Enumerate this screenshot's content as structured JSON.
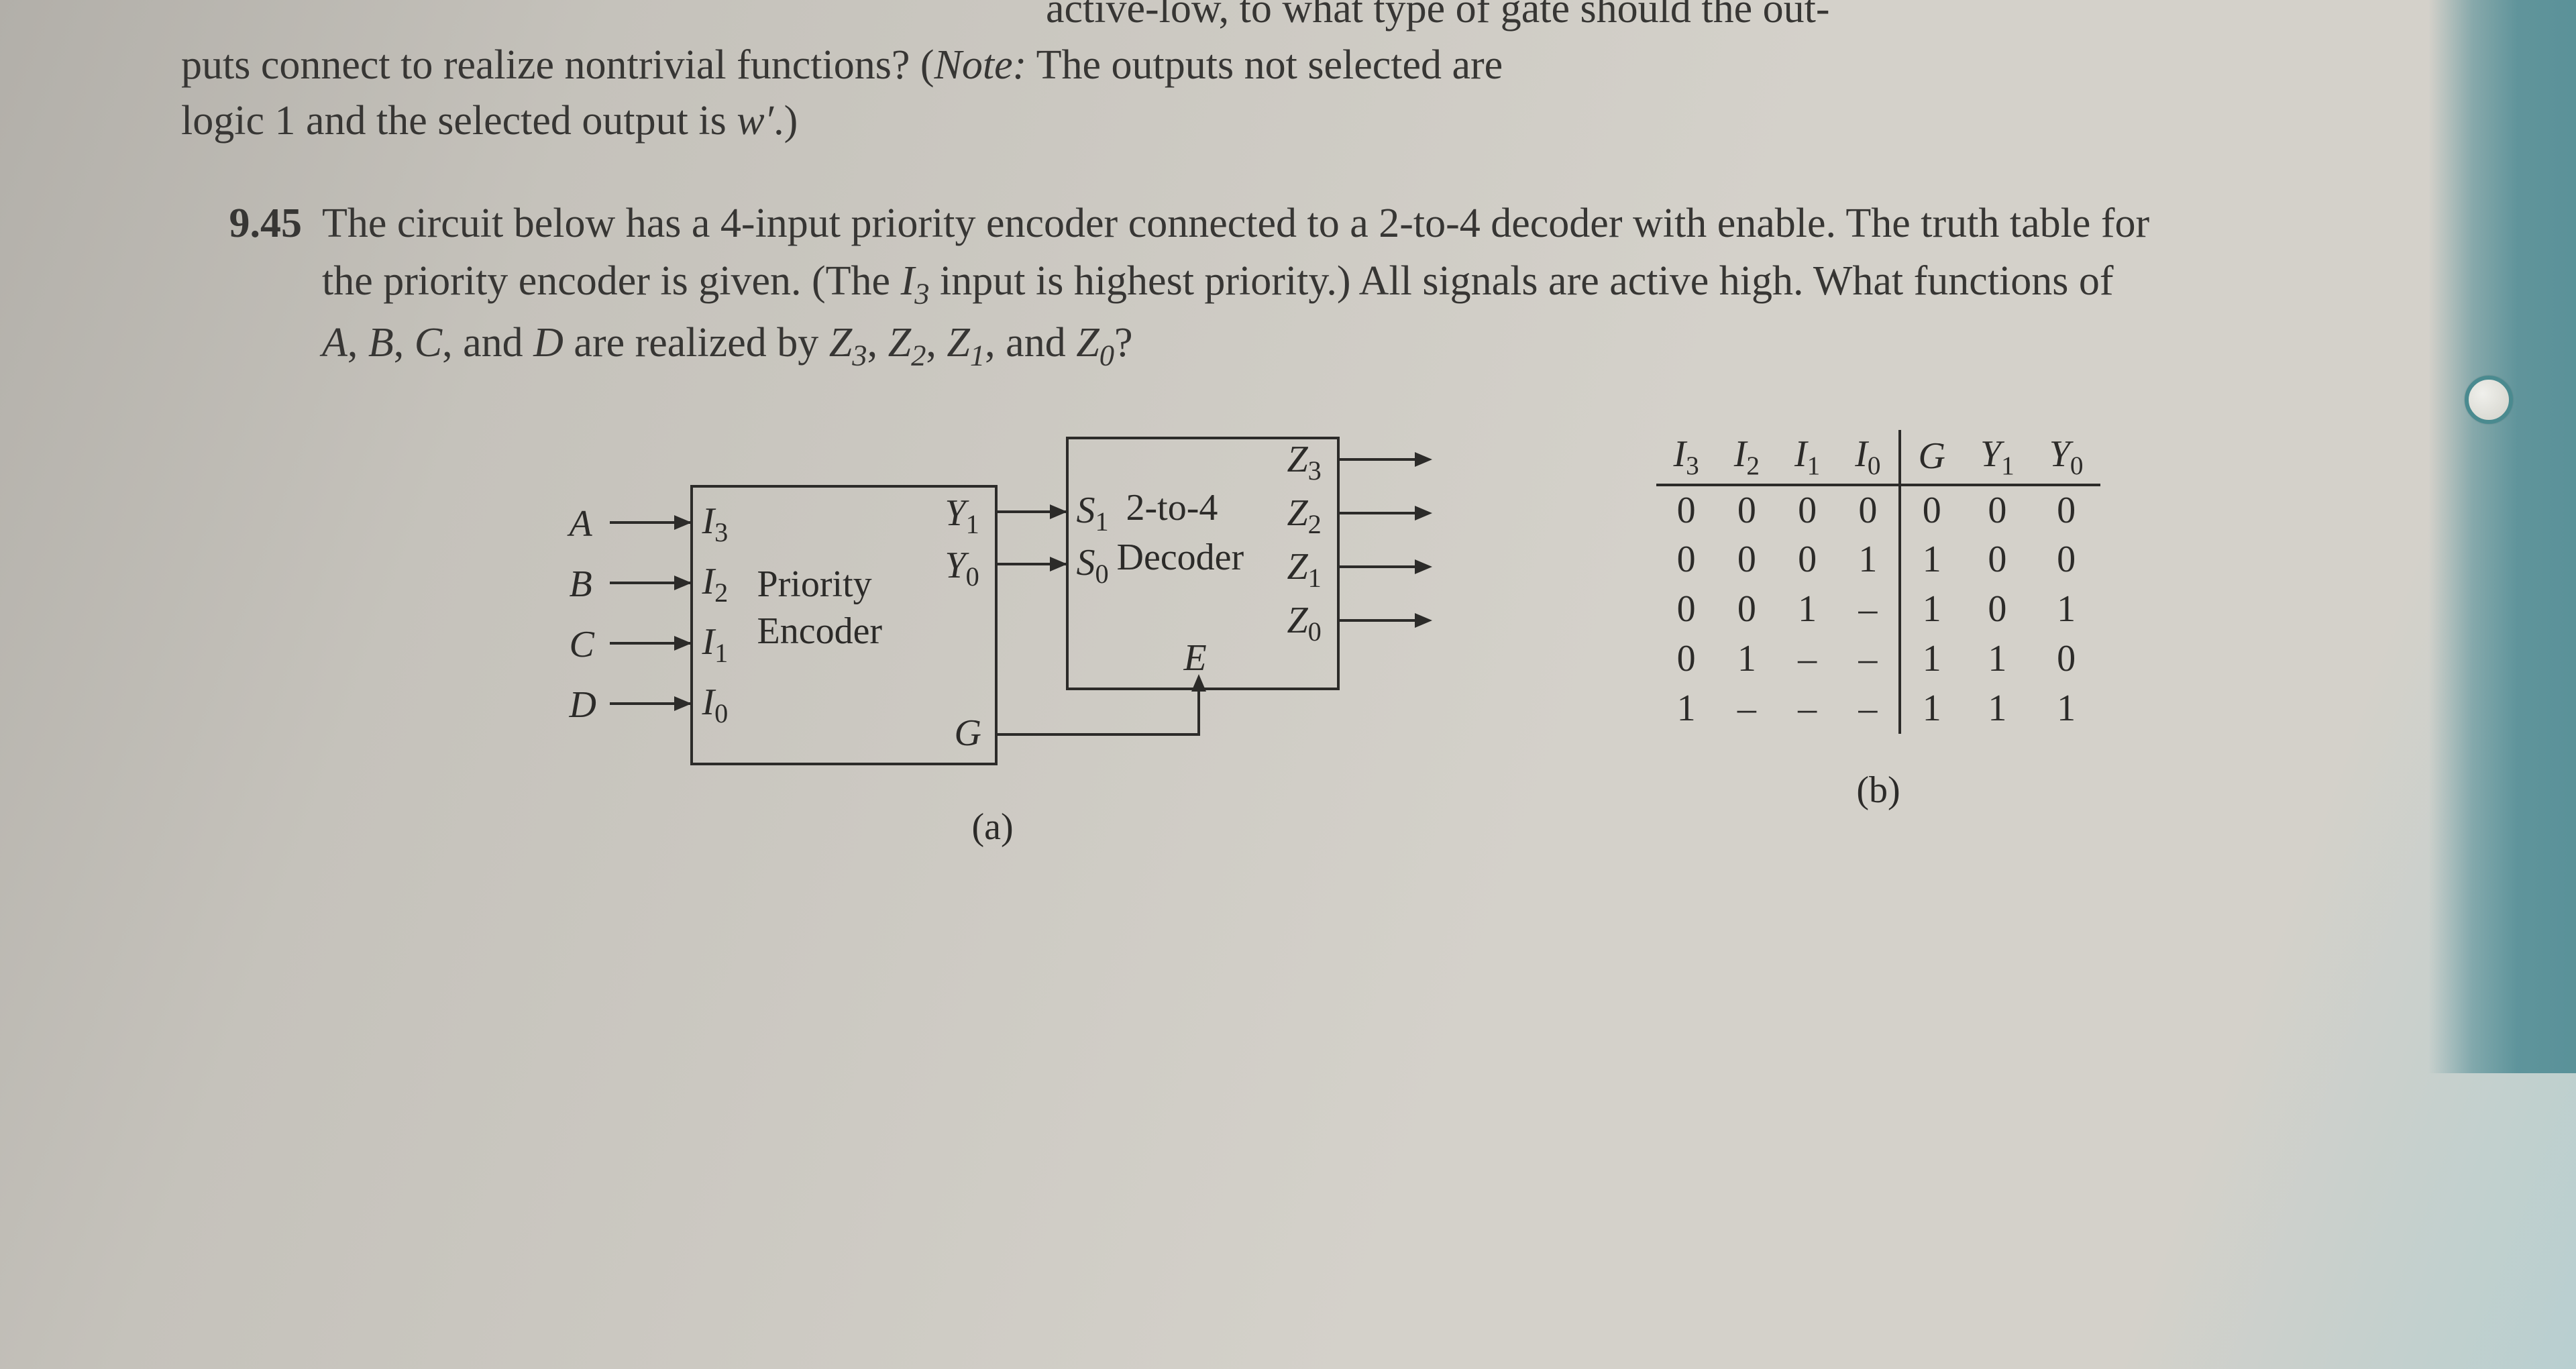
{
  "partialProblem": {
    "line1_fragment": "active-low, to what type of gate should the out-",
    "line2": "puts connect to realize nontrivial functions? (",
    "note_label": "Note:",
    "line2b": " The outputs not selected are",
    "line3a": "logic 1 and the selected output is ",
    "line3_var": "w′",
    "line3b": ".)"
  },
  "problem945": {
    "number": "9.45",
    "text_a": "The circuit below has a 4-input priority encoder connected to a 2-to-4 decoder with enable. The truth table for the priority encoder is given. (The ",
    "I3": "I",
    "I3_sub": "3",
    "text_b": " input is highest priority.) All signals are active high. What functions of ",
    "A": "A",
    "comma1": ", ",
    "B": "B",
    "comma2": ", ",
    "C": "C",
    "comma3": ", and ",
    "D": "D",
    "text_c": " are realized by ",
    "Z3": "Z",
    "Z3s": "3",
    "Z2": "Z",
    "Z2s": "2",
    "Z1": "Z",
    "Z1s": "1",
    "and": ", and ",
    "Z0": "Z",
    "Z0s": "0",
    "q": "?"
  },
  "diagram": {
    "inputs": {
      "A": "A",
      "B": "B",
      "C": "C",
      "D": "D"
    },
    "encoder": {
      "I3": "I",
      "I3s": "3",
      "I2": "I",
      "I2s": "2",
      "I1": "I",
      "I1s": "1",
      "I0": "I",
      "I0s": "0",
      "label": "Priority",
      "label2": "Encoder",
      "Y1": "Y",
      "Y1s": "1",
      "Y0": "Y",
      "Y0s": "0",
      "G": "G"
    },
    "decoder": {
      "S1": "S",
      "S1s": "1",
      "S0": "S",
      "S0s": "0",
      "label": "2-to-4",
      "label2": "Decoder",
      "Z3": "Z",
      "Z3s": "3",
      "Z2": "Z",
      "Z2s": "2",
      "Z1": "Z",
      "Z1s": "1",
      "Z0": "Z",
      "Z0s": "0",
      "E": "E"
    },
    "caption_a": "(a)",
    "caption_b": "(b)"
  },
  "truthTable": {
    "headers": [
      "I₃",
      "I₂",
      "I₁",
      "I₀",
      "G",
      "Y₁",
      "Y₀"
    ],
    "rows": [
      [
        "0",
        "0",
        "0",
        "0",
        "0",
        "0",
        "0"
      ],
      [
        "0",
        "0",
        "0",
        "1",
        "1",
        "0",
        "0"
      ],
      [
        "0",
        "0",
        "1",
        "–",
        "1",
        "0",
        "1"
      ],
      [
        "0",
        "1",
        "–",
        "–",
        "1",
        "1",
        "0"
      ],
      [
        "1",
        "–",
        "–",
        "–",
        "1",
        "1",
        "1"
      ]
    ]
  }
}
